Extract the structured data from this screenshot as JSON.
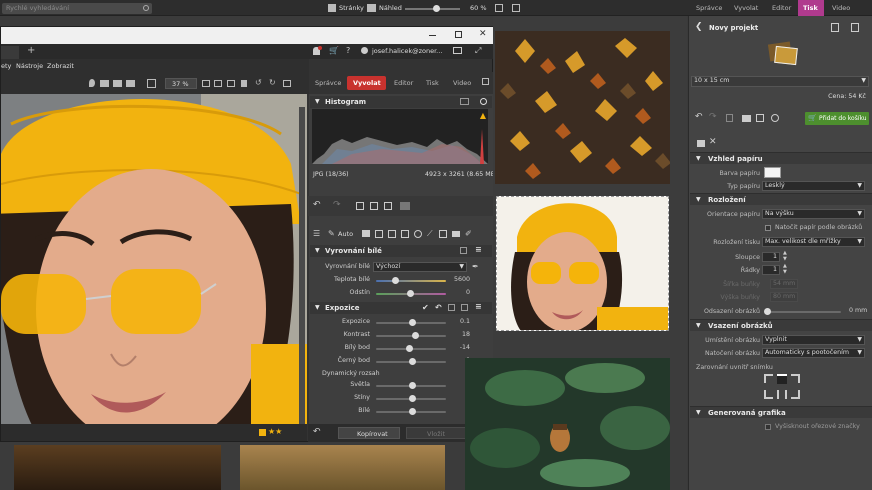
{
  "top_bar": {
    "search_placeholder": "Rychlé vyhledávání",
    "pages_label": "Stránky",
    "preview_label": "Náhled",
    "zoom": "60 %",
    "modes": [
      "Správce",
      "Vyvolat",
      "Editor",
      "Tisk",
      "Video"
    ],
    "active_mode": "Tisk"
  },
  "editor_window": {
    "user": "josef.halicek@zoner...",
    "menu": [
      "ety",
      "Nástroje",
      "Zobrazit"
    ],
    "zoom": "37 %",
    "modes": [
      "Správce",
      "Vyvolat",
      "Editor",
      "Tisk",
      "Video"
    ],
    "active_mode": "Vyvolat",
    "stars": "★★",
    "copy_label": "Kopírovat",
    "paste_label": "Vložit"
  },
  "develop_panel": {
    "histogram_title": "Histogram",
    "file_info": "JPG (18/36)",
    "dimensions": "4923 x 3261 (8.65 MB)",
    "auto_label": "Auto",
    "wb_section": "Vyrovnání bílé",
    "wb_label": "Vyrovnání bílé",
    "wb_value": "Výchozí",
    "temp_label": "Teplota bílé",
    "temp_value": "5600",
    "tint_label": "Odstín",
    "tint_value": "0",
    "exposure_section": "Expozice",
    "exposure_rows": [
      {
        "label": "Expozice",
        "value": "0.1",
        "pos": 0.5
      },
      {
        "label": "Kontrast",
        "value": "18",
        "pos": 0.55
      },
      {
        "label": "Bílý bod",
        "value": "-14",
        "pos": 0.45
      },
      {
        "label": "Černý bod",
        "value": "0",
        "pos": 0.5
      }
    ],
    "dynamic_label": "Dynamický rozsah",
    "dynamic_rows": [
      {
        "label": "Světla",
        "value": "2",
        "pos": 0.5
      },
      {
        "label": "Stíny",
        "value": "0",
        "pos": 0.5
      },
      {
        "label": "Bílé",
        "value": "0",
        "pos": 0.5
      }
    ]
  },
  "print_panel": {
    "project_title": "Novy projekt",
    "paper_size": "10 x 15 cm",
    "price": "Cena: 54 Kč",
    "add_to_cart": "Přidat do košíku",
    "paper_section": "Vzhled papíru",
    "paper_color_label": "Barva papíru",
    "paper_type_label": "Typ papíru",
    "paper_type_value": "Lesklý",
    "layout_section": "Rozložení",
    "orientation_label": "Orientace papíru",
    "orientation_value": "Na výšku",
    "rotate_label": "Natočit papír podle obrázků",
    "print_layout_label": "Rozložení tisku",
    "print_layout_value": "Max. velikost dle mřížky",
    "columns_label": "Sloupce",
    "columns_value": "1",
    "rows_label": "Řádky",
    "rows_value": "1",
    "cell_width_label": "Šířka buňky",
    "cell_width_value": "54 mm",
    "cell_height_label": "Výška buňky",
    "cell_height_value": "80 mm",
    "spacing_label": "Odsazení obrázků",
    "spacing_value": "0 mm",
    "insert_section": "Vsazení obrázků",
    "placement_label": "Umístění obrázku",
    "placement_value": "Vyplnit",
    "rotation_label": "Natočení obrázku",
    "rotation_value": "Automaticky s pootočením",
    "align_label": "Zarovnání uvnitř snímku",
    "generated_section": "Generovaná grafika",
    "fill_label": "Vyšisknout ořezové značky"
  },
  "colors": {
    "accent_red": "#c8322e",
    "tisk_purple": "#b03a8e",
    "cart_green": "#4d8f2e",
    "hat_yellow": "#f2b30f"
  }
}
